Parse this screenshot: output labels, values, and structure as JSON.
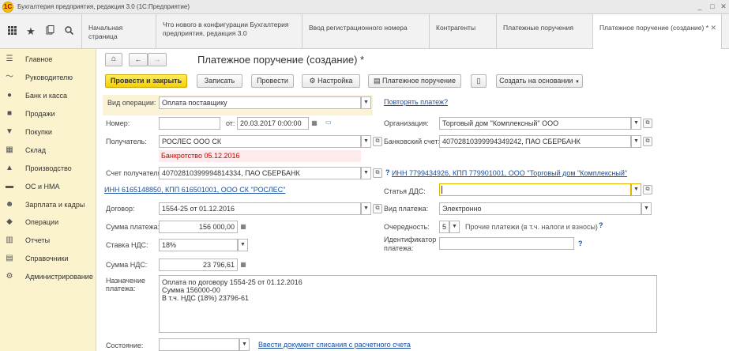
{
  "window": {
    "logo": "1С",
    "title": "Бухгалтерия предприятия, редакция 3.0  (1С:Предприятие)",
    "controls": [
      "_",
      "□",
      "✕"
    ]
  },
  "tabs": [
    {
      "label": "Начальная страница"
    },
    {
      "label": "Что нового в конфигурации Бухгалтерия предприятия, редакция 3.0"
    },
    {
      "label": "Ввод регистрационного номера"
    },
    {
      "label": "Контрагенты"
    },
    {
      "label": "Платежные поручения"
    },
    {
      "label": "Платежное поручение (создание) *"
    }
  ],
  "sidebar": {
    "items": [
      {
        "label": "Главное",
        "icon": "menu-icon"
      },
      {
        "label": "Руководителю",
        "icon": "chart-icon"
      },
      {
        "label": "Банк и касса",
        "icon": "coins-icon"
      },
      {
        "label": "Продажи",
        "icon": "briefcase-icon"
      },
      {
        "label": "Покупки",
        "icon": "cart-icon"
      },
      {
        "label": "Склад",
        "icon": "warehouse-icon"
      },
      {
        "label": "Производство",
        "icon": "factory-icon"
      },
      {
        "label": "ОС и НМА",
        "icon": "car-icon"
      },
      {
        "label": "Зарплата и кадры",
        "icon": "people-icon"
      },
      {
        "label": "Операции",
        "icon": "operations-icon"
      },
      {
        "label": "Отчеты",
        "icon": "report-icon"
      },
      {
        "label": "Справочники",
        "icon": "book-icon"
      },
      {
        "label": "Администрирование",
        "icon": "gear-icon"
      }
    ]
  },
  "form": {
    "title": "Платежное поручение (создание) *",
    "toolbar": {
      "post_close": "Провести и закрыть",
      "save": "Записать",
      "post": "Провести",
      "settings": "Настройка",
      "print": "Платежное поручение",
      "create_based": "Создать на основании"
    },
    "operation_label": "Вид операции:",
    "operation_value": "Оплата поставщику",
    "repeat_link": "Повторять платеж?",
    "number_label": "Номер:",
    "number_value": "",
    "date_label": "от:",
    "date_value": "20.03.2017  0:00:00",
    "org_label": "Организация:",
    "org_value": "Торговый дом \"Комплексный\" ООО",
    "recipient_label": "Получатель:",
    "recipient_value": "РОСЛЕС ООО СК",
    "bank_account_label": "Банковский счет:",
    "bank_account_value": "40702810399994349242, ПАО СБЕРБАНК",
    "bankruptcy_note": "Банкротство 05.12.2016",
    "recipient_account_label": "Счет получателя:",
    "recipient_account_value": "40702810399994814334, ПАО СБЕРБАНК",
    "org_inn_link": "ИНН 7799434926, КПП 779901001, ООО \"Торговый дом \"Комплексный\"",
    "recipient_inn_link": "ИНН 6165148850, КПП 616501001, ООО СК \"РОСЛЕС\"",
    "dds_label": "Статья ДДС:",
    "dds_value": "",
    "contract_label": "Договор:",
    "contract_value": "1554-25 от 01.12.2016",
    "payment_type_label": "Вид платежа:",
    "payment_type_value": "Электронно",
    "amount_label": "Сумма платежа:",
    "amount_value": "156 000,00",
    "priority_label": "Очередность:",
    "priority_value": "5",
    "priority_note": "Прочие платежи (в т.ч. налоги и взносы)",
    "vat_rate_label": "Ставка НДС:",
    "vat_rate_value": "18%",
    "payment_id_label_1": "Идентификатор",
    "payment_id_label_2": "платежа:",
    "payment_id_value": "",
    "vat_amount_label": "Сумма НДС:",
    "vat_amount_value": "23 796,61",
    "purpose_label_1": "Назначение",
    "purpose_label_2": "платежа:",
    "purpose_line_1": "Оплата по договору 1554-25 от 01.12.2016",
    "purpose_line_2": "Сумма 156000-00",
    "purpose_line_3": "В т.ч. НДС  (18%) 23796-61",
    "state_label": "Состояние:",
    "state_value": "",
    "write_off_link": "Ввести документ списания с расчетного счета",
    "help_mark": "?"
  }
}
